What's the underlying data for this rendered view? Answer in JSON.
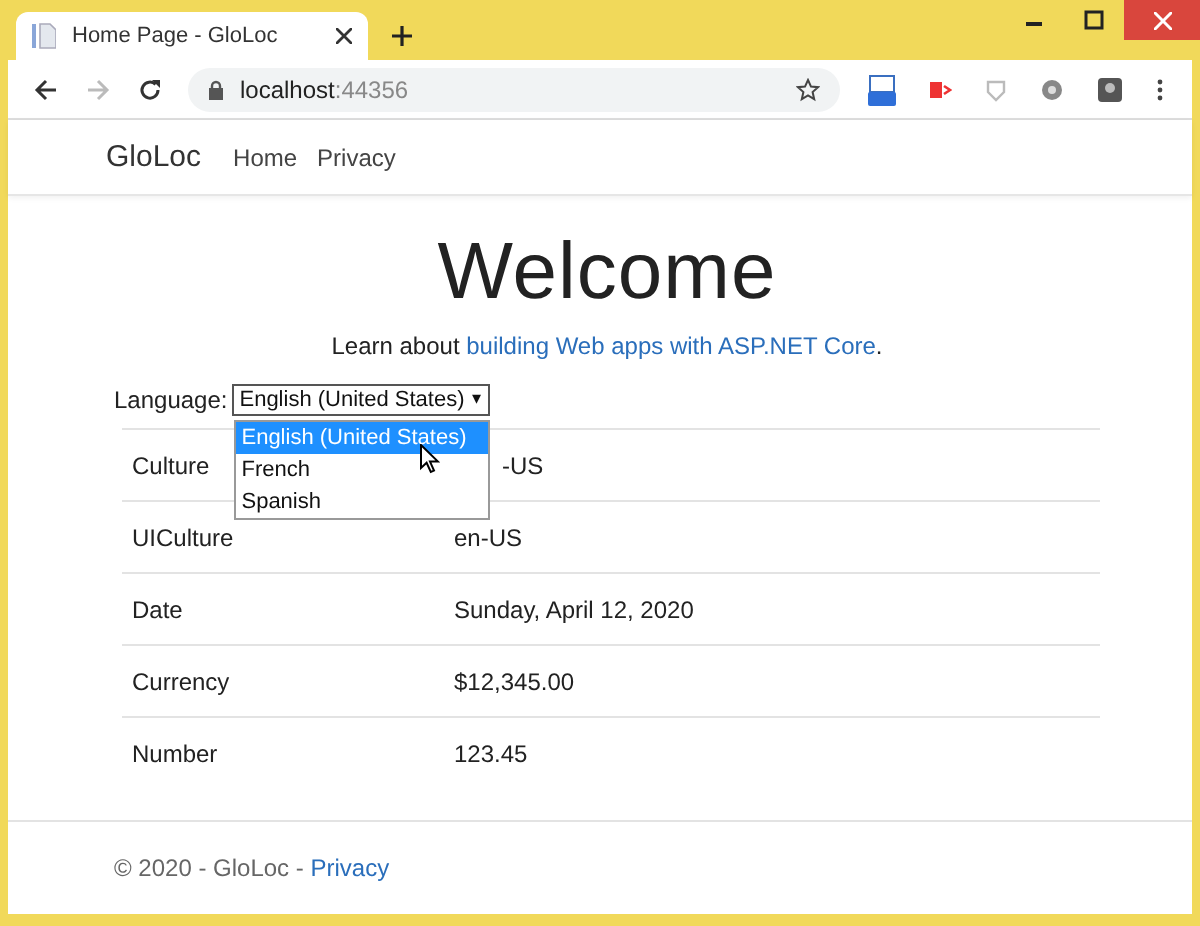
{
  "browser": {
    "tab": {
      "title": "Home Page - GloLoc"
    },
    "address": {
      "host": "localhost",
      "port": ":44356"
    }
  },
  "navbar": {
    "brand": "GloLoc",
    "links": [
      "Home",
      "Privacy"
    ]
  },
  "heading": "Welcome",
  "intro": {
    "text": "Learn about ",
    "link": "building Web apps with ASP.NET Core",
    "end": "."
  },
  "language": {
    "label": "Language:",
    "value": "English (United States)",
    "caret": "▾",
    "options": [
      {
        "label": "English (United States)",
        "selected": true
      },
      {
        "label": "French",
        "selected": false
      },
      {
        "label": "Spanish",
        "selected": false
      }
    ]
  },
  "table": {
    "rows": [
      {
        "name": "Culture",
        "value": "-US"
      },
      {
        "name": "UICulture",
        "value": "en-US"
      },
      {
        "name": "Date",
        "value": "Sunday, April 12, 2020"
      },
      {
        "name": "Currency",
        "value": "$12,345.00"
      },
      {
        "name": "Number",
        "value": "123.45"
      }
    ]
  },
  "footer": {
    "text": "© 2020 - GloLoc - ",
    "link": "Privacy"
  }
}
